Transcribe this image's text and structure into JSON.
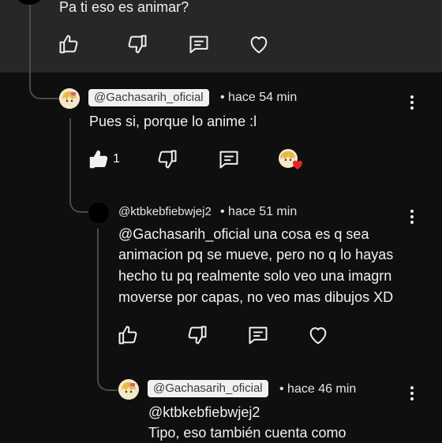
{
  "top_comment": {
    "text": "Pa ti eso es animar?"
  },
  "replies": [
    {
      "handle": "@Gachasarih_oficial",
      "time": "• hace 54 min",
      "lines": [
        "Pues si, porque lo anime :l"
      ],
      "like_count": "1"
    },
    {
      "handle": "@ktbkebfiebwjej2",
      "time": "• hace 51 min",
      "lines": [
        " @Gachasarih_oficial  una cosa es q sea",
        "animacion pq se mueve, pero no q lo hayas",
        "hecho tu pq realmente solo veo una imagrn",
        "moverse por capas, no veo mas dibujos XD"
      ]
    },
    {
      "handle": "@Gachasarih_oficial",
      "time": "• hace 46 min",
      "lines": [
        "@ktbkebfiebwjej2",
        "Tipo, eso también cuenta como"
      ]
    }
  ],
  "colors": {
    "background": "#0f0f0f",
    "top_band": "#272727",
    "heart_badge": "#e5232b",
    "chip": "#f1f1f1"
  }
}
